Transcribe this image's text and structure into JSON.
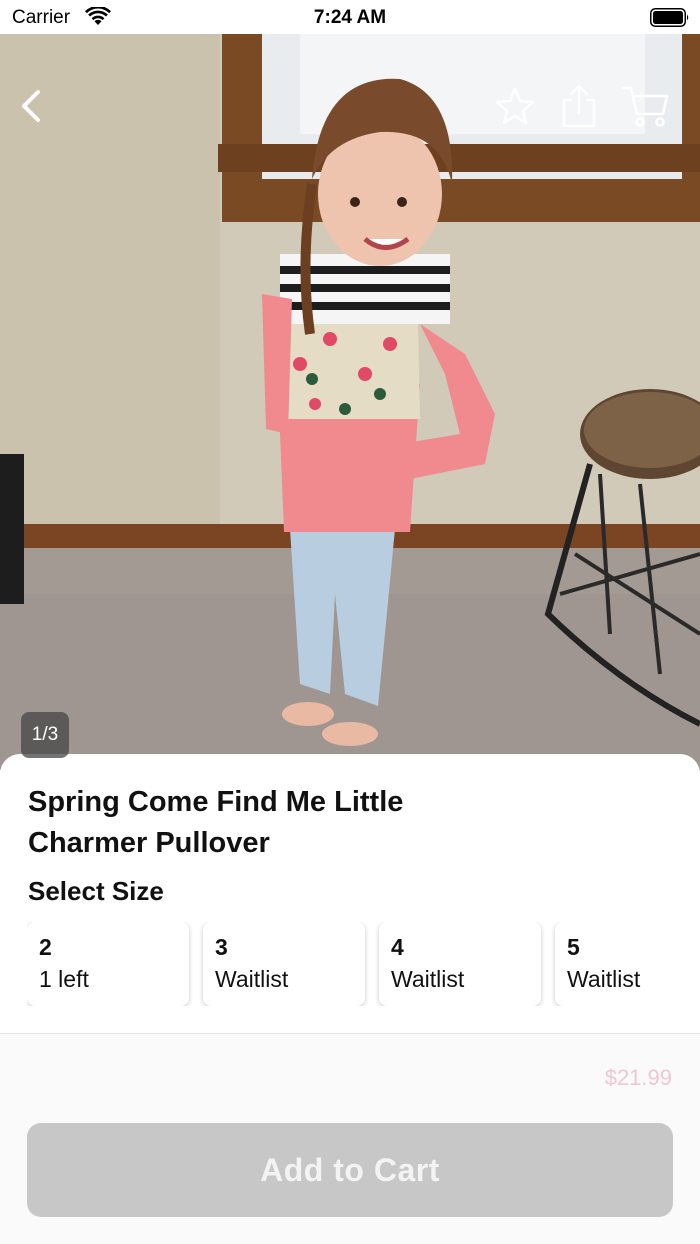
{
  "status_bar": {
    "carrier": "Carrier",
    "time": "7:24 AM"
  },
  "nav": {
    "icons": [
      "back-chevron-icon",
      "favorite-star-icon",
      "share-icon",
      "cart-icon"
    ]
  },
  "gallery": {
    "counter": "1/3"
  },
  "product": {
    "title": "Spring Come Find Me Little Charmer Pullover",
    "select_size_label": "Select Size",
    "sizes": [
      {
        "size": "2",
        "status": "1 left"
      },
      {
        "size": "3",
        "status": "Waitlist"
      },
      {
        "size": "4",
        "status": "Waitlist"
      },
      {
        "size": "5",
        "status": "Waitlist"
      }
    ],
    "price": "$21.99",
    "add_to_cart_label": "Add to Cart"
  },
  "colors": {
    "price": "#f0c6d2",
    "button_disabled": "#c7c7c7"
  }
}
